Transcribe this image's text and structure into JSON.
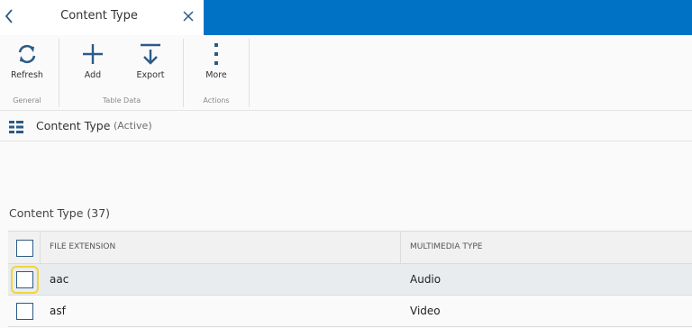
{
  "tab": {
    "title": "Content Type"
  },
  "ribbon": {
    "buttons": [
      {
        "label": "Refresh",
        "icon": "refresh-icon"
      },
      {
        "label": "Add",
        "icon": "plus-icon"
      },
      {
        "label": "Export",
        "icon": "export-icon"
      },
      {
        "label": "More",
        "icon": "more-vertical-icon"
      }
    ],
    "groups": [
      "General",
      "Table Data",
      "Actions"
    ]
  },
  "breadcrumb": {
    "title": "Content Type",
    "status": "(Active)"
  },
  "section": {
    "title": "Content Type (37)"
  },
  "table": {
    "columns": [
      "FILE EXTENSION",
      "MULTIMEDIA TYPE"
    ],
    "rows": [
      {
        "extension": "aac",
        "type": "Audio"
      },
      {
        "extension": "asf",
        "type": "Video"
      }
    ]
  },
  "colors": {
    "accent": "#0072c6",
    "icon_blue": "#2b5b86",
    "focus": "#f2d43b"
  }
}
